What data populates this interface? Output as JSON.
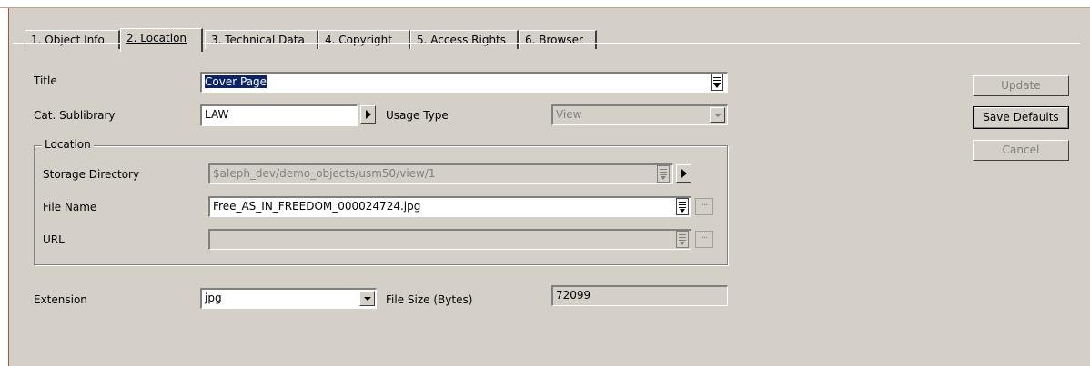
{
  "tabs": [
    {
      "label": "1. Object Info",
      "active": false
    },
    {
      "label": "2. Location",
      "active": true
    },
    {
      "label": "3. Technical Data",
      "active": false
    },
    {
      "label": "4. Copyright",
      "active": false
    },
    {
      "label": "5. Access Rights",
      "active": false
    },
    {
      "label": "6. Browser",
      "active": false
    }
  ],
  "form": {
    "title_label": "Title",
    "title_value": "Cover Page",
    "cat_sublibrary_label": "Cat. Sublibrary",
    "cat_sublibrary_value": "LAW",
    "usage_type_label": "Usage Type",
    "usage_type_value": "View",
    "location_group_label": "Location",
    "storage_directory_label": "Storage Directory",
    "storage_directory_value": "$aleph_dev/demo_objects/usm50/view/1",
    "file_name_label": "File Name",
    "file_name_value": "Free_AS_IN_FREEDOM_000024724.jpg",
    "url_label": "URL",
    "url_value": "",
    "extension_label": "Extension",
    "extension_value": "jpg",
    "file_size_label": "File Size (Bytes)",
    "file_size_value": "72099"
  },
  "buttons": {
    "update": "Update",
    "save_defaults": "Save Defaults",
    "cancel": "Cancel"
  },
  "icons": {
    "list": "list-icon",
    "arrow": "right-arrow-icon",
    "ellipsis": "ellipsis-icon",
    "dropdown": "chevron-down-icon"
  }
}
